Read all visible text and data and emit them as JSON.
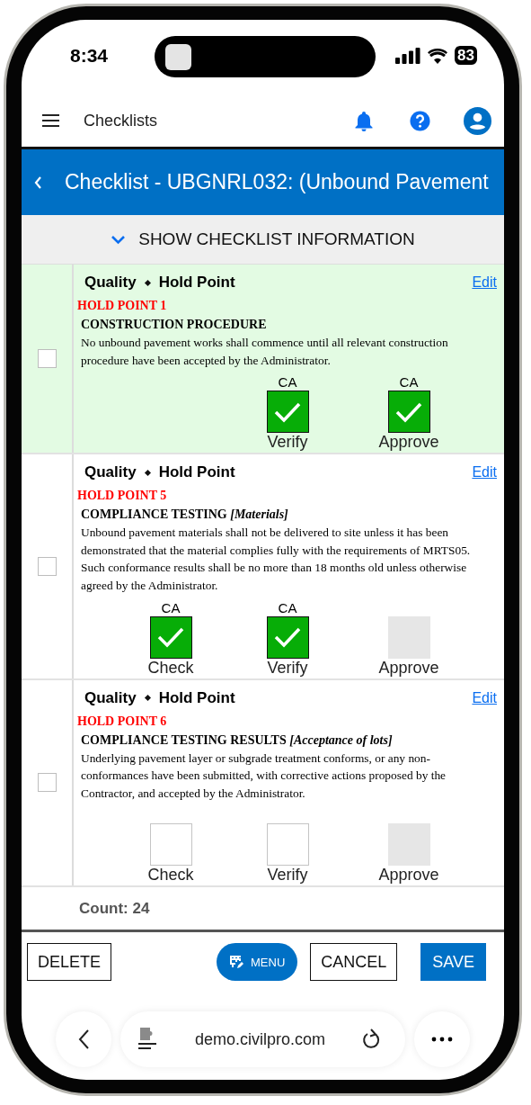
{
  "status_bar": {
    "time": "8:34",
    "battery": "83"
  },
  "app_bar": {
    "title": "Checklists"
  },
  "header": {
    "title": "Checklist - UBGNRL032: (Unbound Pavement"
  },
  "info_toggle": {
    "label": "SHOW CHECKLIST INFORMATION",
    "expanded": false
  },
  "items": [
    {
      "category": "Quality",
      "type": "Hold Point",
      "edit": "Edit",
      "selected": true,
      "checked": false,
      "code": "HOLD POINT 1",
      "heading": "CONSTRUCTION PROCEDURE",
      "text": "No unbound pavement works shall commence until all relevant construction procedure have been accepted by the Administrator.",
      "signoffs": [
        {
          "role": "CA",
          "label": "Verify",
          "signed": true,
          "disabled": false
        },
        {
          "role": "CA",
          "label": "Approve",
          "signed": true,
          "disabled": false
        }
      ]
    },
    {
      "category": "Quality",
      "type": "Hold Point",
      "edit": "Edit",
      "selected": false,
      "checked": false,
      "code": "HOLD POINT 5",
      "heading": "COMPLIANCE TESTING *[Materials]*",
      "text": "Unbound pavement materials shall not be delivered to site unless it has been demonstrated that the material complies fully with the requirements of MRTS05. Such conformance results shall be no more than 18 months old unless otherwise agreed by the Administrator.",
      "signoffs": [
        {
          "role": "CA",
          "label": "Check",
          "signed": true,
          "disabled": false
        },
        {
          "role": "CA",
          "label": "Verify",
          "signed": true,
          "disabled": false
        },
        {
          "label": "Approve",
          "signed": false,
          "disabled": true
        }
      ]
    },
    {
      "category": "Quality",
      "type": "Hold Point",
      "edit": "Edit",
      "selected": false,
      "checked": false,
      "code": "HOLD POINT 6",
      "heading": "COMPLIANCE TESTING RESULTS *[Acceptance of lots]*",
      "text": "Underlying pavement layer or subgrade treatment conforms, or any non-conformances have been submitted, with corrective actions proposed by the Contractor, and accepted by the Administrator.",
      "signoffs": [
        {
          "label": "Check",
          "signed": false,
          "disabled": false
        },
        {
          "label": "Verify",
          "signed": false,
          "disabled": false
        },
        {
          "label": "Approve",
          "signed": false,
          "disabled": true
        }
      ]
    }
  ],
  "count": "Count: 24",
  "actions": [
    {
      "label": "DELETE",
      "kind": "outline"
    },
    {
      "label": "MENU",
      "kind": "pill"
    },
    {
      "label": "CANCEL",
      "kind": "outline"
    },
    {
      "label": "SAVE",
      "kind": "primary"
    }
  ],
  "browser": {
    "url": "demo.civilpro.com"
  }
}
